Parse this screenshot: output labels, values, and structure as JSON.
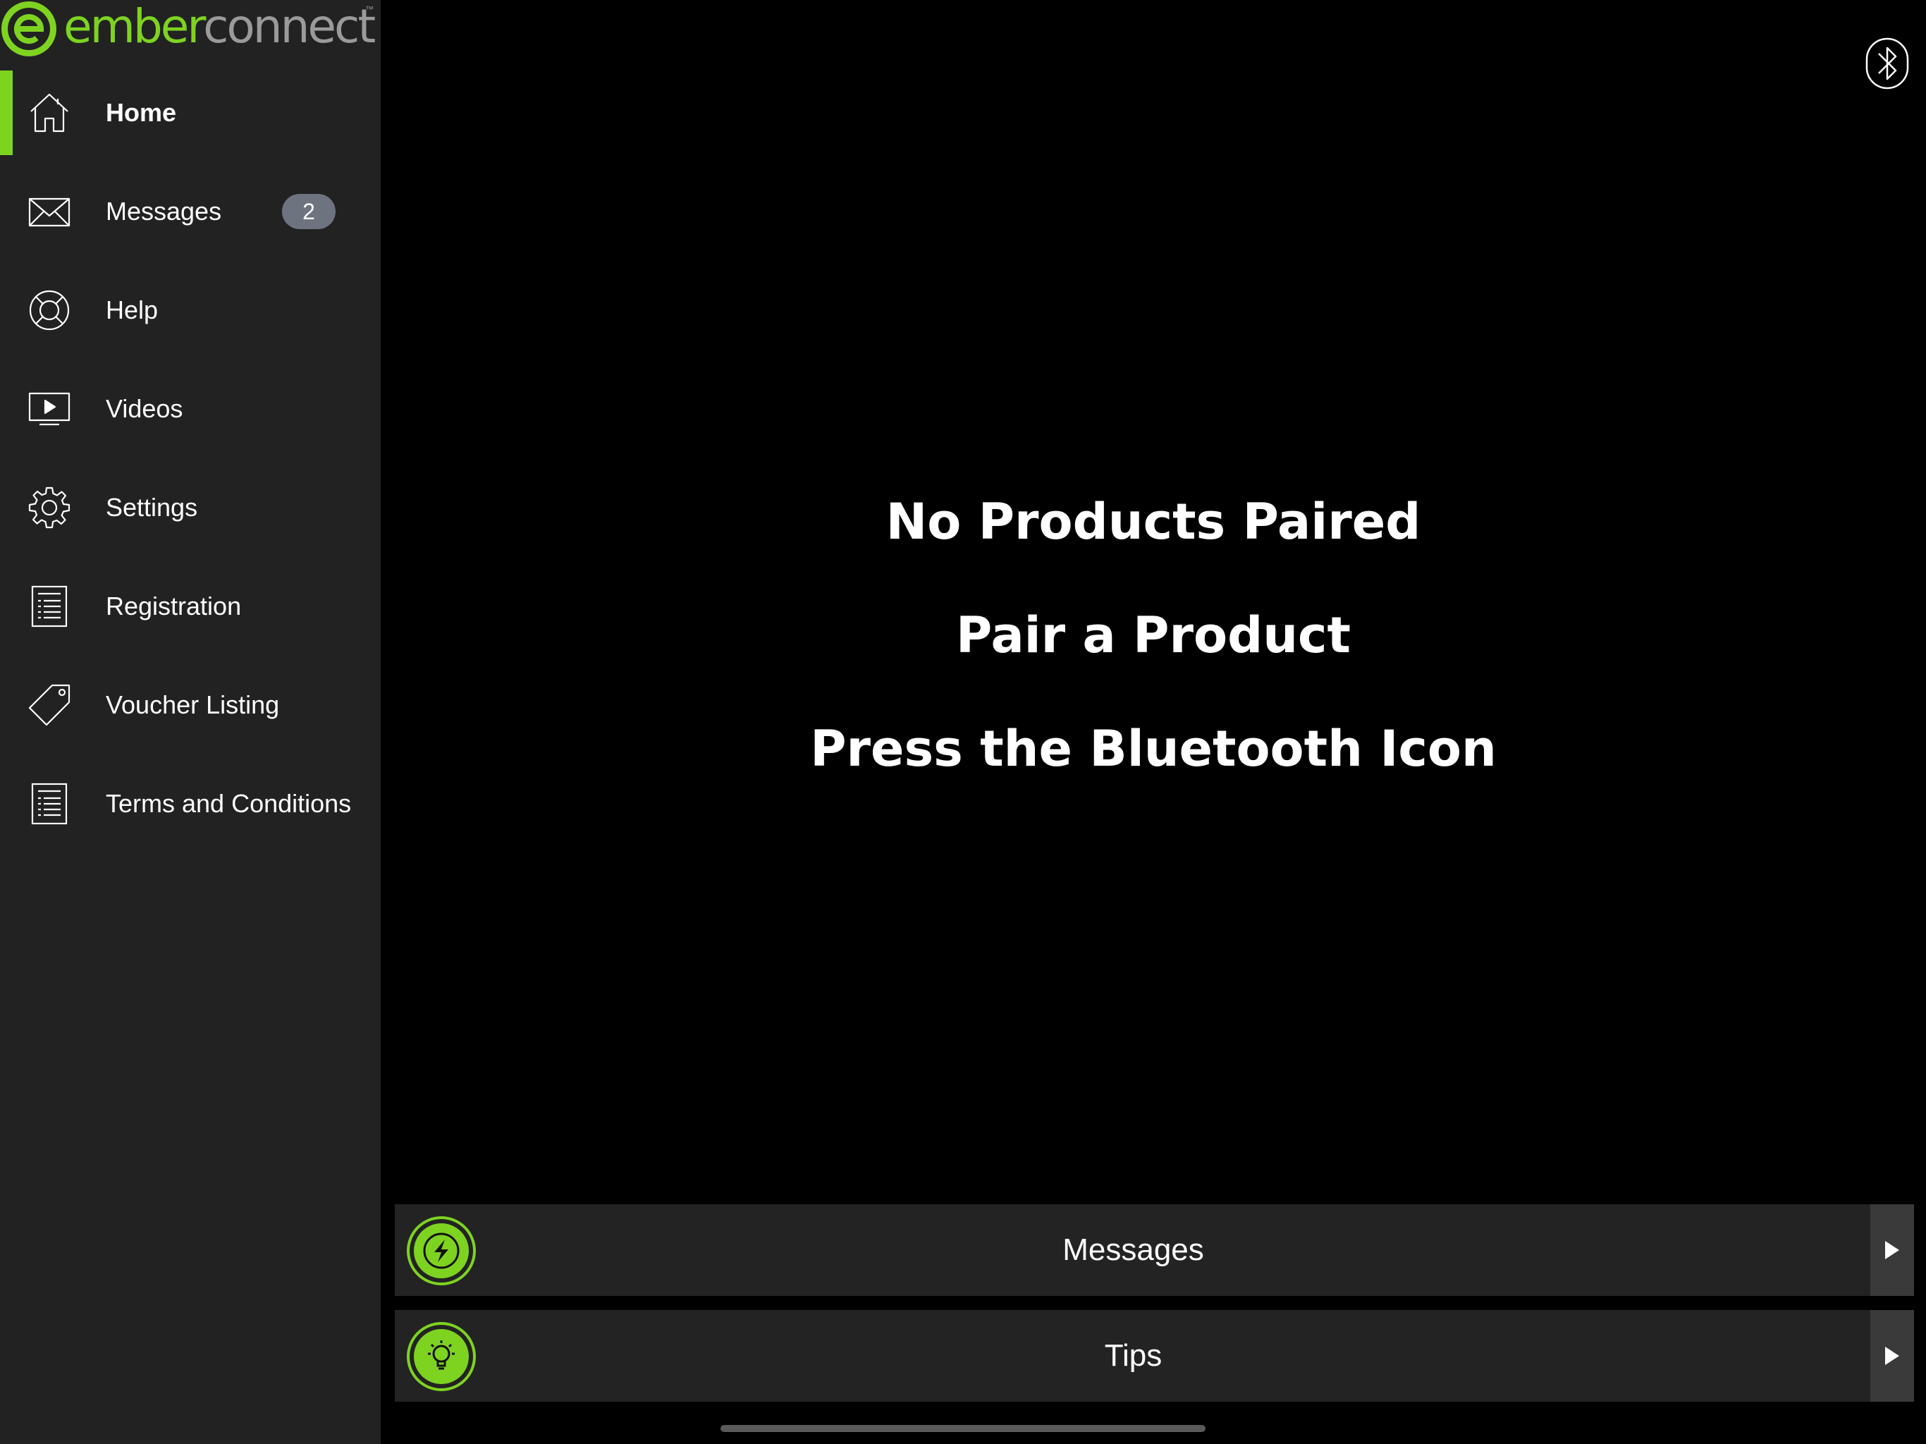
{
  "app": {
    "logo_ember": "ember",
    "logo_connect": "connect",
    "logo_tm": "™",
    "accent_color": "#7ed321"
  },
  "sidebar": {
    "items": [
      {
        "label": "Home",
        "icon": "home-icon",
        "active": true
      },
      {
        "label": "Messages",
        "icon": "envelope-icon",
        "badge": "2"
      },
      {
        "label": "Help",
        "icon": "lifebuoy-icon"
      },
      {
        "label": "Videos",
        "icon": "video-play-icon"
      },
      {
        "label": "Settings",
        "icon": "gear-icon"
      },
      {
        "label": "Registration",
        "icon": "document-list-icon"
      },
      {
        "label": "Voucher Listing",
        "icon": "tag-icon"
      },
      {
        "label": "Terms and Conditions",
        "icon": "document-list-icon"
      }
    ]
  },
  "main": {
    "bluetooth_icon": "bluetooth-icon",
    "headlines": [
      "No Products Paired",
      "Pair a Product",
      "Press the Bluetooth Icon"
    ],
    "cards": [
      {
        "label": "Messages",
        "icon": "lightning-bolt-icon"
      },
      {
        "label": "Tips",
        "icon": "lightbulb-icon"
      }
    ]
  }
}
